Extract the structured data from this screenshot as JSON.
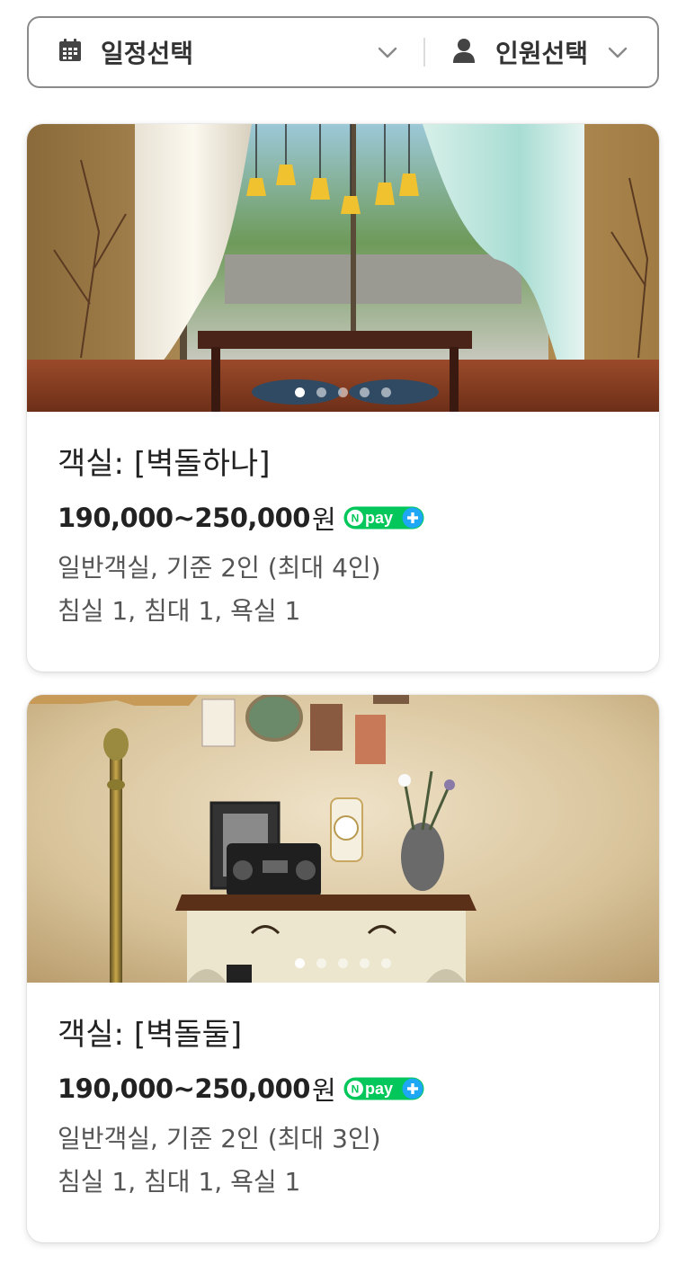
{
  "filter": {
    "date_label": "일정선택",
    "people_label": "인원선택"
  },
  "rooms": [
    {
      "name": "객실: [벽돌하나]",
      "price": "190,000~250,000",
      "currency": "원",
      "pay_badge": "pay",
      "type_capacity": "일반객실, 기준 2인 (최대 4인)",
      "facilities": "침실 1, 침대 1, 욕실 1",
      "photo_count": 5,
      "active_photo": 1
    },
    {
      "name": "객실: [벽돌둘]",
      "price": "190,000~250,000",
      "currency": "원",
      "pay_badge": "pay",
      "type_capacity": "일반객실, 기준 2인 (최대 3인)",
      "facilities": "침실 1, 침대 1, 욕실 1",
      "photo_count": 5,
      "active_photo": 1
    }
  ],
  "colors": {
    "npay_green": "#03c75a",
    "npay_blue": "#1ea7f5",
    "border": "#8a8a8a"
  }
}
